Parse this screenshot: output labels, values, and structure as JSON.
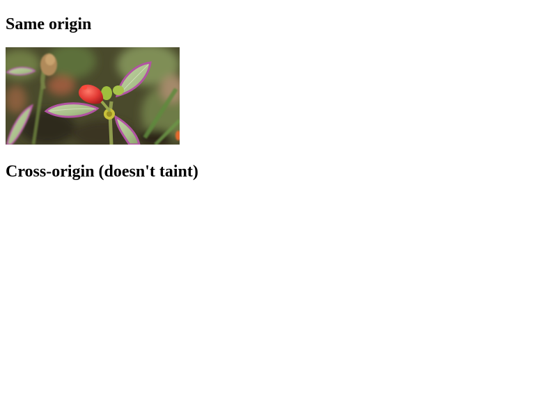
{
  "sections": {
    "same_origin": {
      "heading": "Same origin",
      "image": {
        "subject": "plant-with-red-bud-photo"
      }
    },
    "cross_origin": {
      "heading": "Cross-origin (doesn't taint)"
    }
  }
}
